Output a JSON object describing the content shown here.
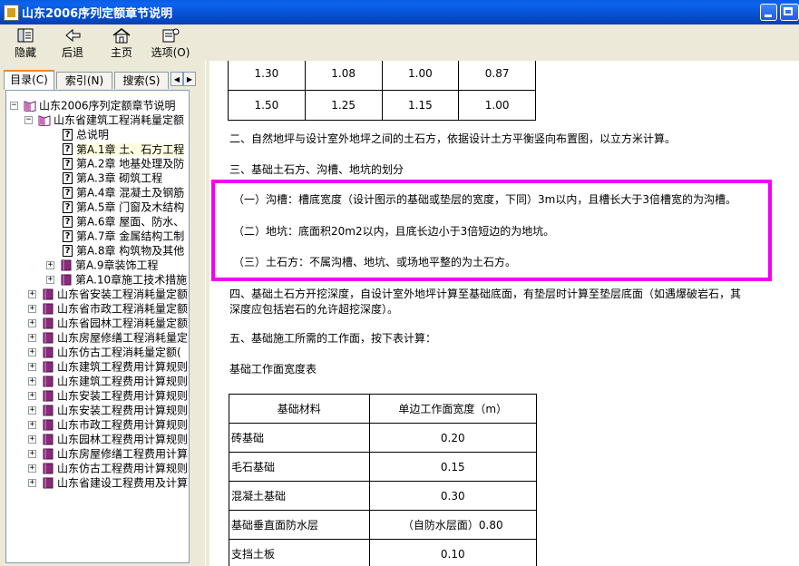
{
  "window": {
    "title": "山东2006序列定额章节说明"
  },
  "toolbar": {
    "hide_label": "隐藏",
    "back_label": "后退",
    "home_label": "主页",
    "options_label": "选项(O)"
  },
  "tabs": {
    "contents": "目录(C)",
    "index": "索引(N)",
    "search": "搜索(S)"
  },
  "tree": {
    "root": "山东2006序列定额章节说明",
    "building": "山东省建筑工程消耗量定额",
    "items": [
      "总说明",
      "第A.1章 土、石方工程",
      "第A.2章 地基处理及防",
      "第A.3章 砌筑工程",
      "第A.4章 混凝土及钢筋",
      "第A.5章 门窗及木结构",
      "第A.6章 屋面、防水、",
      "第A.7章 金属结构工制",
      "第A.8章 构筑物及其他"
    ],
    "book_items": [
      "第A.9章装饰工程",
      "第A.10章施工技术措施"
    ],
    "others": [
      "山东省安装工程消耗量定额",
      "山东省市政工程消耗量定额",
      "山东省园林工程消耗量定额",
      "山东房屋修缮工程消耗量定",
      "山东仿古工程消耗量定额(",
      "山东建筑工程费用计算规则",
      "山东建筑工程费用计算规则",
      "山东安装工程费用计算规则",
      "山东安装工程费用计算规则",
      "山东市政工程费用计算规则",
      "山东园林工程费用计算规则",
      "山东房屋修缮工程费用计算",
      "山东仿古工程费用计算规则",
      "山东省建设工程费用及计算"
    ]
  },
  "content": {
    "top_table": [
      [
        "1.30",
        "1.08",
        "1.00",
        "0.87"
      ],
      [
        "1.50",
        "1.25",
        "1.15",
        "1.00"
      ]
    ],
    "p2": "二、自然地坪与设计室外地坪之间的土石方，依据设计土方平衡竖向布置图，以立方米计算。",
    "p3": "三、基础土石方、沟槽、地坑的划分",
    "p3a": "（一）沟槽：槽底宽度（设计图示的基础或垫层的宽度，下同）3m以内，且槽长大于3倍槽宽的为沟槽。",
    "p3b": "（二）地坑：底面积20m2以内，且底长边小于3倍短边的为地坑。",
    "p3c": "（三）土石方：不属沟槽、地坑、或场地平整的为土石方。",
    "p4a": "四、基础土石方开挖深度，自设计室外地坪计算至基础底面，有垫层时计算至垫层底面（如遇爆破岩石，其",
    "p4b": "深度应包括岩石的允许超挖深度）。",
    "p5": "五、基础施工所需的工作面，按下表计算：",
    "table_title": "基础工作面宽度表",
    "table_header": [
      "基础材料",
      "单边工作面宽度（m）"
    ],
    "table_rows": [
      [
        "砖基础",
        "0.20"
      ],
      [
        "毛石基础",
        "0.15"
      ],
      [
        "混凝土基础",
        "0.30"
      ],
      [
        "基础垂直面防水层",
        "（自防水层面）0.80"
      ],
      [
        "支挡土板",
        "0.10"
      ]
    ]
  }
}
